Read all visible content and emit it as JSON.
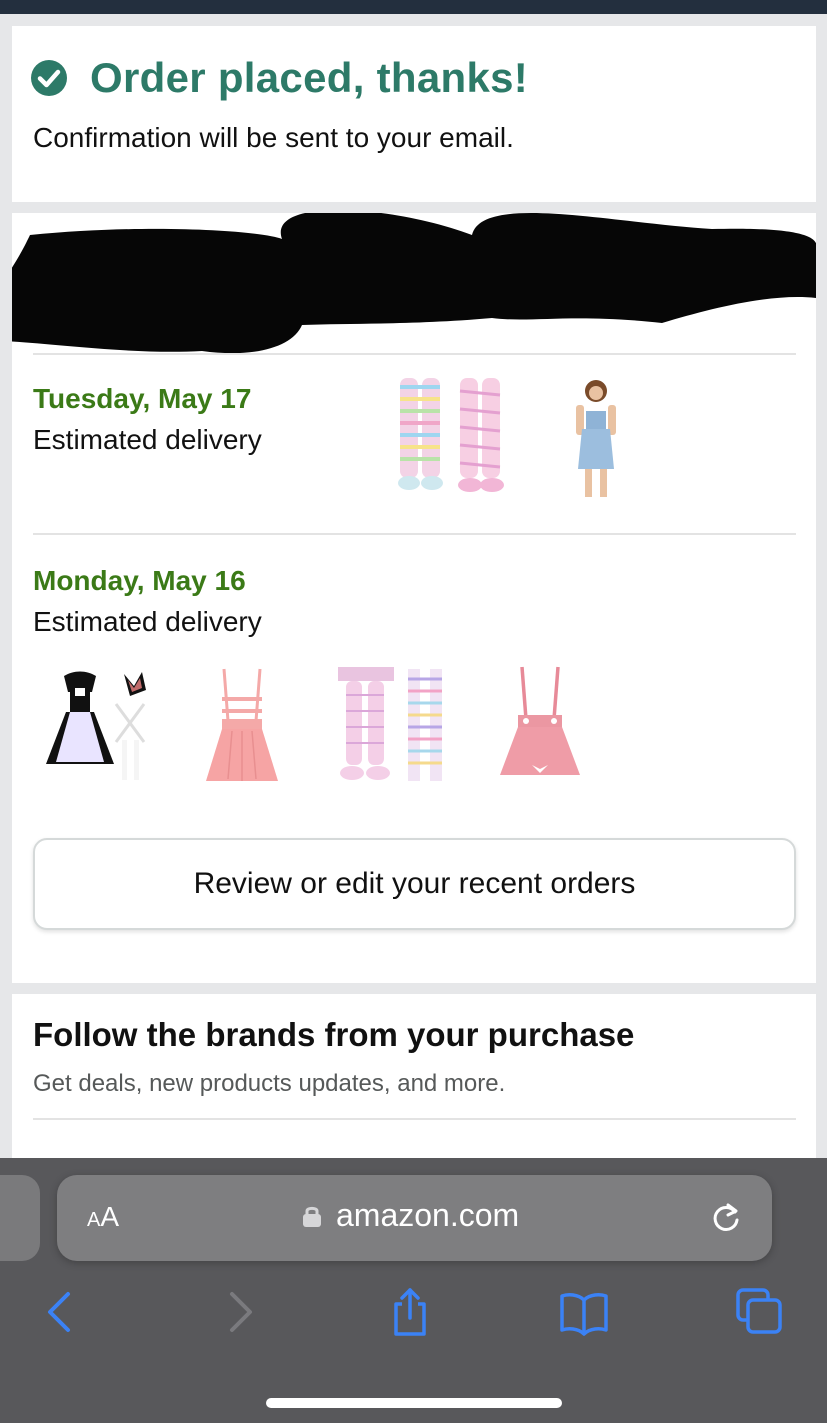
{
  "confirmation": {
    "title": "Order placed, thanks!",
    "subtitle": "Confirmation will be sent to your email."
  },
  "deliveries": [
    {
      "date": "Tuesday, May 17",
      "label": "Estimated delivery",
      "items": [
        "striped-thigh-high-socks",
        "denim-overall-dress"
      ]
    },
    {
      "date": "Monday, May 16",
      "label": "Estimated delivery",
      "items": [
        "maid-costume-set",
        "pink-suspender-skirt",
        "pastel-striped-socks",
        "pink-bow-suspender-skirt"
      ]
    }
  ],
  "review_button": {
    "label": "Review or edit your recent orders"
  },
  "brands": {
    "title": "Follow the brands from your purchase",
    "subtitle": "Get deals, new products updates, and more."
  },
  "browser": {
    "text_size_label_small": "A",
    "text_size_label_large": "A",
    "url": "amazon.com"
  },
  "colors": {
    "success_green": "#2d7a68",
    "delivery_green": "#3b7a17",
    "safari_blue": "#3b82f6"
  }
}
